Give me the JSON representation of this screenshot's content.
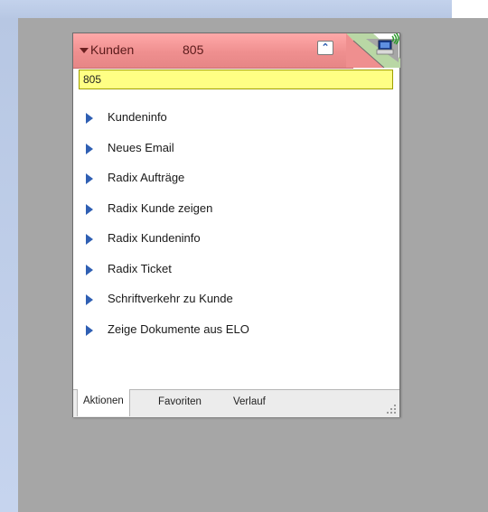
{
  "panel": {
    "title": "Kunden",
    "number": "805",
    "collapse_icon": "chevron-double-up-icon",
    "status_icon": "network-computer-icon"
  },
  "search": {
    "value": "805"
  },
  "actions": [
    "Kundeninfo",
    "Neues Email",
    "Radix Aufträge",
    "Radix Kunde zeigen",
    "Radix Kundeninfo",
    "Radix Ticket",
    "Schriftverkehr zu Kunde",
    "Zeige Dokumente aus ELO"
  ],
  "tabs": [
    "Aktionen",
    "Favoriten",
    "Verlauf"
  ],
  "colors": {
    "header": "#ef8f8f",
    "search_bg": "#ffff84",
    "action_arrow": "#2f5fb3"
  }
}
